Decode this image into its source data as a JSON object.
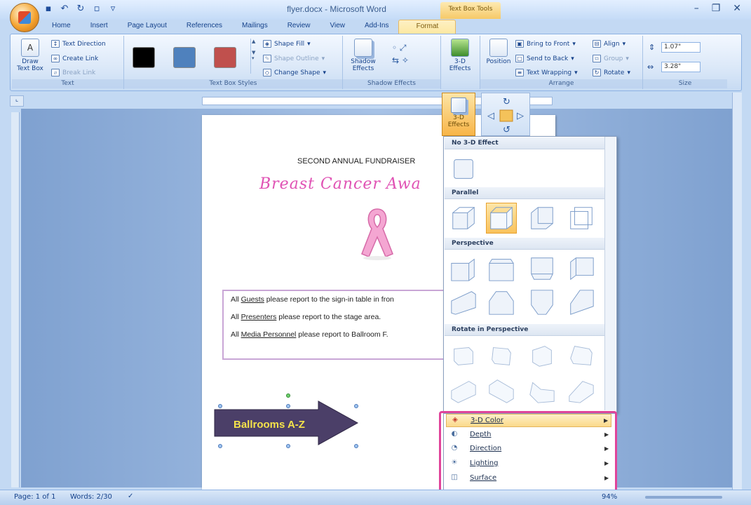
{
  "window": {
    "title": "flyer.docx - Microsoft Word",
    "contextual_tools_label": "Text Box Tools"
  },
  "tabs": [
    "Home",
    "Insert",
    "Page Layout",
    "References",
    "Mailings",
    "Review",
    "View",
    "Add-Ins",
    "Format"
  ],
  "ribbon": {
    "text_group": {
      "label": "Text",
      "draw_text_box": "Draw Text Box",
      "text_direction": "Text Direction",
      "create_link": "Create Link",
      "break_link": "Break Link"
    },
    "styles_group": {
      "label": "Text Box Styles",
      "swatches": [
        "#000000",
        "#4f81bd",
        "#c0504d"
      ],
      "shape_fill": "Shape Fill",
      "shape_outline": "Shape Outline",
      "change_shape": "Change Shape"
    },
    "shadow_group": {
      "label": "Shadow Effects",
      "button": "Shadow Effects"
    },
    "threed_group": {
      "button": "3-D Effects"
    },
    "arrange_group": {
      "label": "Arrange",
      "position": "Position",
      "bring_to_front": "Bring to Front",
      "send_to_back": "Send to Back",
      "text_wrapping": "Text Wrapping",
      "align": "Align",
      "group": "Group",
      "rotate": "Rotate"
    },
    "size_group": {
      "label": "Size",
      "height": "1.07\"",
      "width": "3.28\""
    }
  },
  "document": {
    "heading": "SECOND ANNUAL FUNDRAISER",
    "title": "Breast Cancer Awa",
    "instructions": [
      {
        "lead": "All ",
        "underlined": "Guests",
        "rest": " please report to the sign-in table in fron"
      },
      {
        "lead": "All ",
        "underlined": "Presenters",
        "rest": " please report to the stage area."
      },
      {
        "lead": "All ",
        "underlined": "Media Personnel",
        "rest": " please report to Ballroom F."
      }
    ],
    "arrow_label": "Ballrooms A-Z"
  },
  "threed_button": "3-D Effects",
  "gallery": {
    "sections": [
      "No 3-D Effect",
      "Parallel",
      "Perspective",
      "Rotate in Perspective"
    ]
  },
  "options_menu": {
    "items": [
      {
        "label": "3-D Color",
        "icon": "paint-bucket-icon"
      },
      {
        "label": "Depth",
        "icon": "depth-icon"
      },
      {
        "label": "Direction",
        "icon": "direction-icon"
      },
      {
        "label": "Lighting",
        "icon": "lighting-icon"
      },
      {
        "label": "Surface",
        "icon": "surface-icon"
      }
    ]
  },
  "status": {
    "page": "Page: 1 of 1",
    "words": "Words: 2/30",
    "zoom": "94%"
  }
}
